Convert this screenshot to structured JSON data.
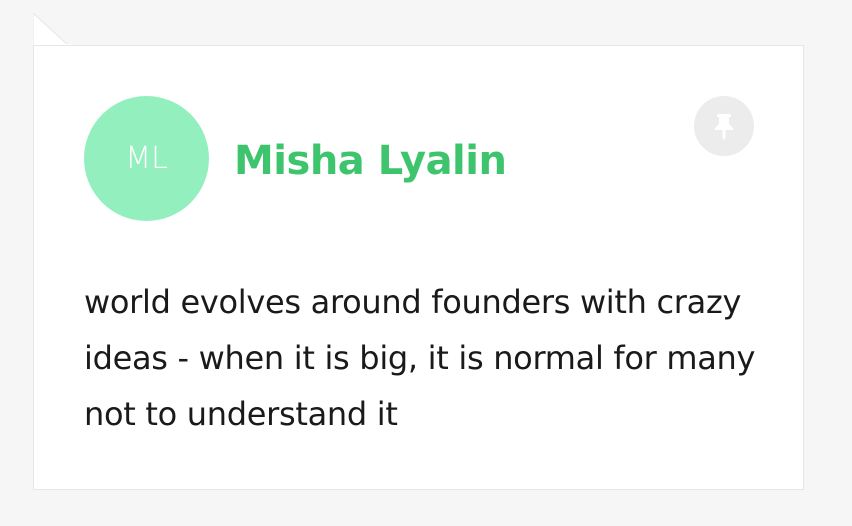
{
  "card": {
    "avatar": {
      "initials": "ML",
      "background": "#94efbf"
    },
    "author_name": "Misha Lyalin",
    "author_color": "#3ec46c",
    "pin_icon": "pin-icon",
    "quote": "world evolves around founders with crazy ideas - when it is big, it is normal for many not to understand it"
  }
}
